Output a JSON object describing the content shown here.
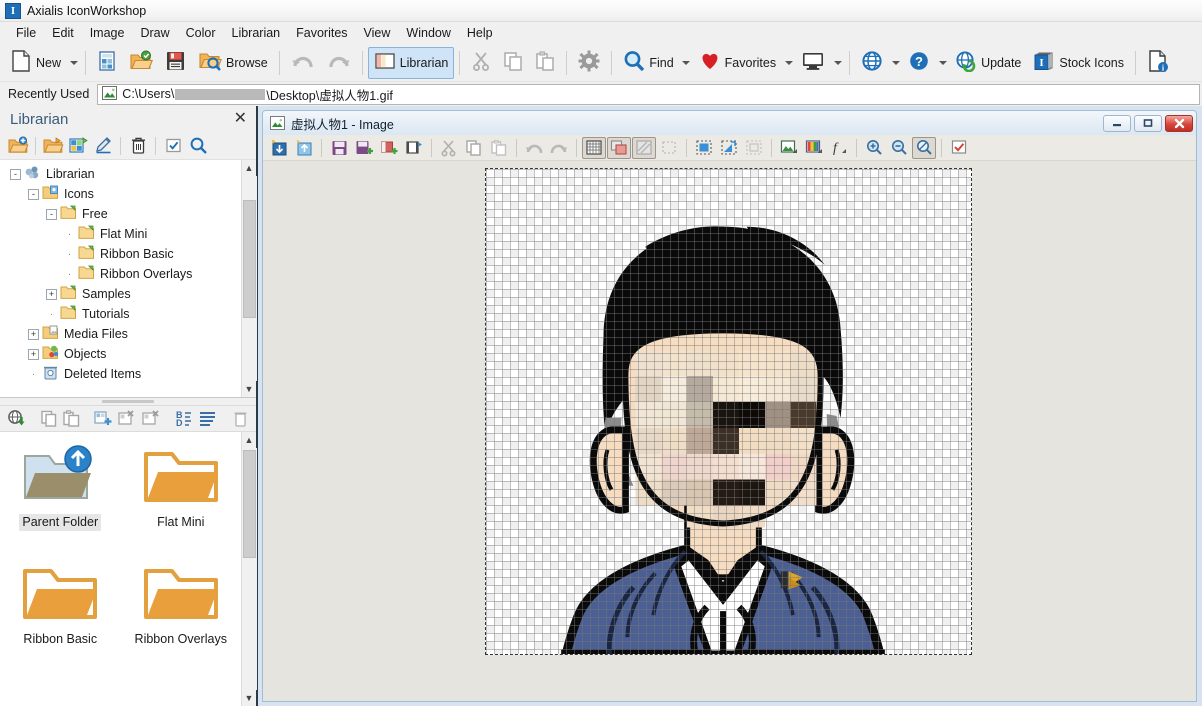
{
  "window": {
    "app_title": "Axialis IconWorkshop",
    "app_icon": "I"
  },
  "menubar": {
    "items": [
      {
        "label": "File"
      },
      {
        "label": "Edit"
      },
      {
        "label": "Image"
      },
      {
        "label": "Draw"
      },
      {
        "label": "Color"
      },
      {
        "label": "Librarian"
      },
      {
        "label": "Favorites"
      },
      {
        "label": "View"
      },
      {
        "label": "Window"
      },
      {
        "label": "Help"
      }
    ]
  },
  "toolbar": {
    "new_label": "New",
    "browse_label": "Browse",
    "librarian_label": "Librarian",
    "find_label": "Find",
    "favorites_label": "Favorites",
    "update_label": "Update",
    "stock_icons_label": "Stock Icons",
    "icons": {
      "new": "new-document-icon",
      "new_dropdown": "new-dropdown-caret",
      "new_from_image": "new-from-image-icon",
      "open": "open-folder-icon",
      "save": "save-floppy-icon",
      "browse": "browse-folder-icon",
      "undo": "undo-arrow-icon",
      "redo": "redo-arrow-icon",
      "librarian": "librarian-panel-icon",
      "cut": "cut-scissors-icon",
      "copy": "copy-icon",
      "paste": "paste-icon",
      "settings": "gear-icon",
      "find": "find-magnifier-icon",
      "favorites": "heart-icon",
      "screen": "monitor-icon",
      "web": "globe-icon",
      "help": "help-question-icon",
      "update": "update-globe-refresh-icon",
      "stock_icons": "stock-icons-icon",
      "about": "document-info-icon"
    }
  },
  "recent": {
    "label": "Recently Used",
    "icon": "image-file-icon",
    "path_prefix": "C:\\Users\\",
    "path_suffix": "\\Desktop\\虚拟人物1.gif",
    "redacted": true
  },
  "librarian": {
    "title": "Librarian",
    "close_label": "✕",
    "toolbar_icons": [
      "new-library-folder-icon",
      "open-library-folder-icon",
      "new-library-icon",
      "rename-pencil-icon",
      "delete-trash-icon",
      "check-properties-icon",
      "search-magnifier-icon"
    ],
    "tree": [
      {
        "label": "Librarian",
        "indent": 0,
        "expander": "-",
        "icon": "librarian-root-icon"
      },
      {
        "label": "Icons",
        "indent": 1,
        "expander": "-",
        "icon": "icons-folder-icon"
      },
      {
        "label": "Free",
        "indent": 2,
        "expander": "-",
        "icon": "folder-icon"
      },
      {
        "label": "Flat Mini",
        "indent": 3,
        "expander": "",
        "icon": "folder-icon"
      },
      {
        "label": "Ribbon Basic",
        "indent": 3,
        "expander": "",
        "icon": "folder-icon"
      },
      {
        "label": "Ribbon Overlays",
        "indent": 3,
        "expander": "",
        "icon": "folder-icon"
      },
      {
        "label": "Samples",
        "indent": 2,
        "expander": "+",
        "icon": "folder-icon"
      },
      {
        "label": "Tutorials",
        "indent": 2,
        "expander": "",
        "icon": "folder-icon"
      },
      {
        "label": "Media Files",
        "indent": 1,
        "expander": "+",
        "icon": "media-folder-icon"
      },
      {
        "label": "Objects",
        "indent": 1,
        "expander": "+",
        "icon": "objects-folder-icon"
      },
      {
        "label": "Deleted Items",
        "indent": 1,
        "expander": "",
        "icon": "deleted-items-icon"
      }
    ],
    "content_toolbar_icons": [
      "download-globe-icon",
      "copy-icon",
      "paste-icon",
      "add-item-icon",
      "remove-item-icon",
      "replace-item-icon",
      "sort-icon",
      "list-view-icon",
      "delete-trash-icon"
    ],
    "folders": [
      {
        "label": "Parent Folder",
        "icon": "parent-folder-icon",
        "selected": true
      },
      {
        "label": "Flat Mini",
        "icon": "folder-icon",
        "selected": false
      },
      {
        "label": "Ribbon Basic",
        "icon": "folder-icon",
        "selected": false
      },
      {
        "label": "Ribbon Overlays",
        "icon": "folder-icon",
        "selected": false
      }
    ]
  },
  "child_window": {
    "title": "虚拟人物1 - Image",
    "icon": "image-file-icon",
    "minimize_label": "–",
    "maximize_label": "▫",
    "close_label": "✕",
    "toolbar_icons": [
      "import-image-icon",
      "export-image-icon",
      "save-image-icon",
      "save-as-icon",
      "add-image-icon",
      "add-frame-icon",
      "cut-scissors-icon",
      "copy-icon",
      "paste-icon",
      "undo-arrow-icon",
      "redo-arrow-icon",
      "grid-toggle-icon",
      "transparency-toggle-icon",
      "overlay-toggle-icon",
      "select-none-icon",
      "select-all-icon",
      "select-move-icon",
      "select-crop-icon",
      "adjust-levels-icon",
      "color-picker-icon",
      "effects-icon",
      "zoom-in-icon",
      "zoom-out-icon",
      "zoom-fit-icon",
      "validate-icon"
    ],
    "canvas": {
      "image_name": "虚拟人物1.gif",
      "description": "Cartoon male avatar in blue suit with white shirt, black hair, pixelated (mosaic) face",
      "grid_visible": true,
      "transparency_checker": true,
      "colors": {
        "hair": "#0d0d0d",
        "skin": "#f6dcc0",
        "suit": "#4a5f93",
        "shirt": "#ffffff",
        "outline": "#101010",
        "pin": "#d9a520"
      }
    }
  }
}
